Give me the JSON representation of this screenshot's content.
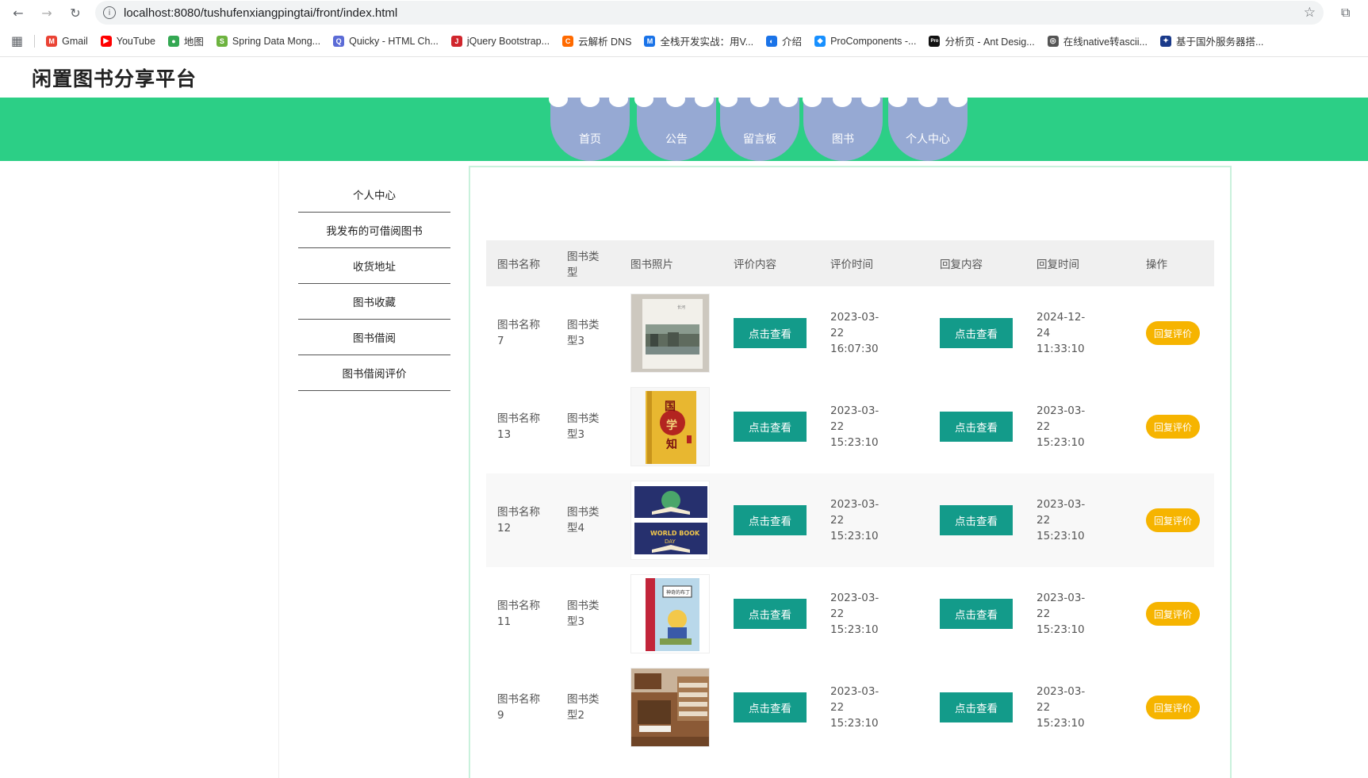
{
  "browser": {
    "url": "localhost:8080/tushufenxiangpingtai/front/index.html",
    "bookmarks": [
      {
        "label": "Gmail",
        "color": "#ea4335",
        "glyph": "M"
      },
      {
        "label": "YouTube",
        "color": "#ff0000",
        "glyph": "▶"
      },
      {
        "label": "地图",
        "color": "#34a853",
        "glyph": "●"
      },
      {
        "label": "Spring Data Mong...",
        "color": "#6db33f",
        "glyph": "S"
      },
      {
        "label": "Quicky - HTML Ch...",
        "color": "#5b6bd6",
        "glyph": "Q"
      },
      {
        "label": "jQuery Bootstrap...",
        "color": "#d0262d",
        "glyph": "J"
      },
      {
        "label": "云解析 DNS",
        "color": "#ff6a00",
        "glyph": "C"
      },
      {
        "label": "全栈开发实战：用V...",
        "color": "#1a73e8",
        "glyph": "M"
      },
      {
        "label": "介绍",
        "color": "#1a73e8",
        "glyph": "◐"
      },
      {
        "label": "ProComponents -...",
        "color": "#1890ff",
        "glyph": "◆"
      },
      {
        "label": "分析页 - Ant Desig...",
        "color": "#111111",
        "glyph": "Pro"
      },
      {
        "label": "在线native转ascii...",
        "color": "#555555",
        "glyph": "◎"
      },
      {
        "label": "基于国外服务器搭...",
        "color": "#1a3a8a",
        "glyph": "✦"
      }
    ]
  },
  "site": {
    "title": "闲置图书分享平台",
    "nav": [
      "首页",
      "公告",
      "留言板",
      "图书",
      "个人中心"
    ]
  },
  "sidebar": {
    "items": [
      "个人中心",
      "我发布的可借阅图书",
      "收货地址",
      "图书收藏",
      "图书借阅",
      "图书借阅评价"
    ]
  },
  "table": {
    "headers": [
      "图书名称",
      "图书类型",
      "图书照片",
      "评价内容",
      "评价时间",
      "回复内容",
      "回复时间",
      "操作"
    ],
    "view_label": "点击查看",
    "reply_label": "回复评价",
    "rows": [
      {
        "name": "图书名称7",
        "type": "图书类型3",
        "photo": "photo-landscape",
        "review_time": "2023-03-22 16:07:30",
        "reply_time": "2024-12-24 11:33:10"
      },
      {
        "name": "图书名称13",
        "type": "图书类型3",
        "photo": "photo-yellow-book",
        "review_time": "2023-03-22 15:23:10",
        "reply_time": "2023-03-22 15:23:10"
      },
      {
        "name": "图书名称12",
        "type": "图书类型4",
        "photo": "photo-world-book-day",
        "review_time": "2023-03-22 15:23:10",
        "reply_time": "2023-03-22 15:23:10"
      },
      {
        "name": "图书名称11",
        "type": "图书类型3",
        "photo": "photo-children-book",
        "review_time": "2023-03-22 15:23:10",
        "reply_time": "2023-03-22 15:23:10"
      },
      {
        "name": "图书名称9",
        "type": "图书类型2",
        "photo": "photo-bookshelf",
        "review_time": "2023-03-22 15:23:10",
        "reply_time": "2023-03-22 15:23:10"
      }
    ]
  },
  "colors": {
    "accent_green": "#2ccf86",
    "nav_blue": "#96a9d3",
    "button_teal": "#139b8a",
    "button_yellow": "#f6b400"
  }
}
